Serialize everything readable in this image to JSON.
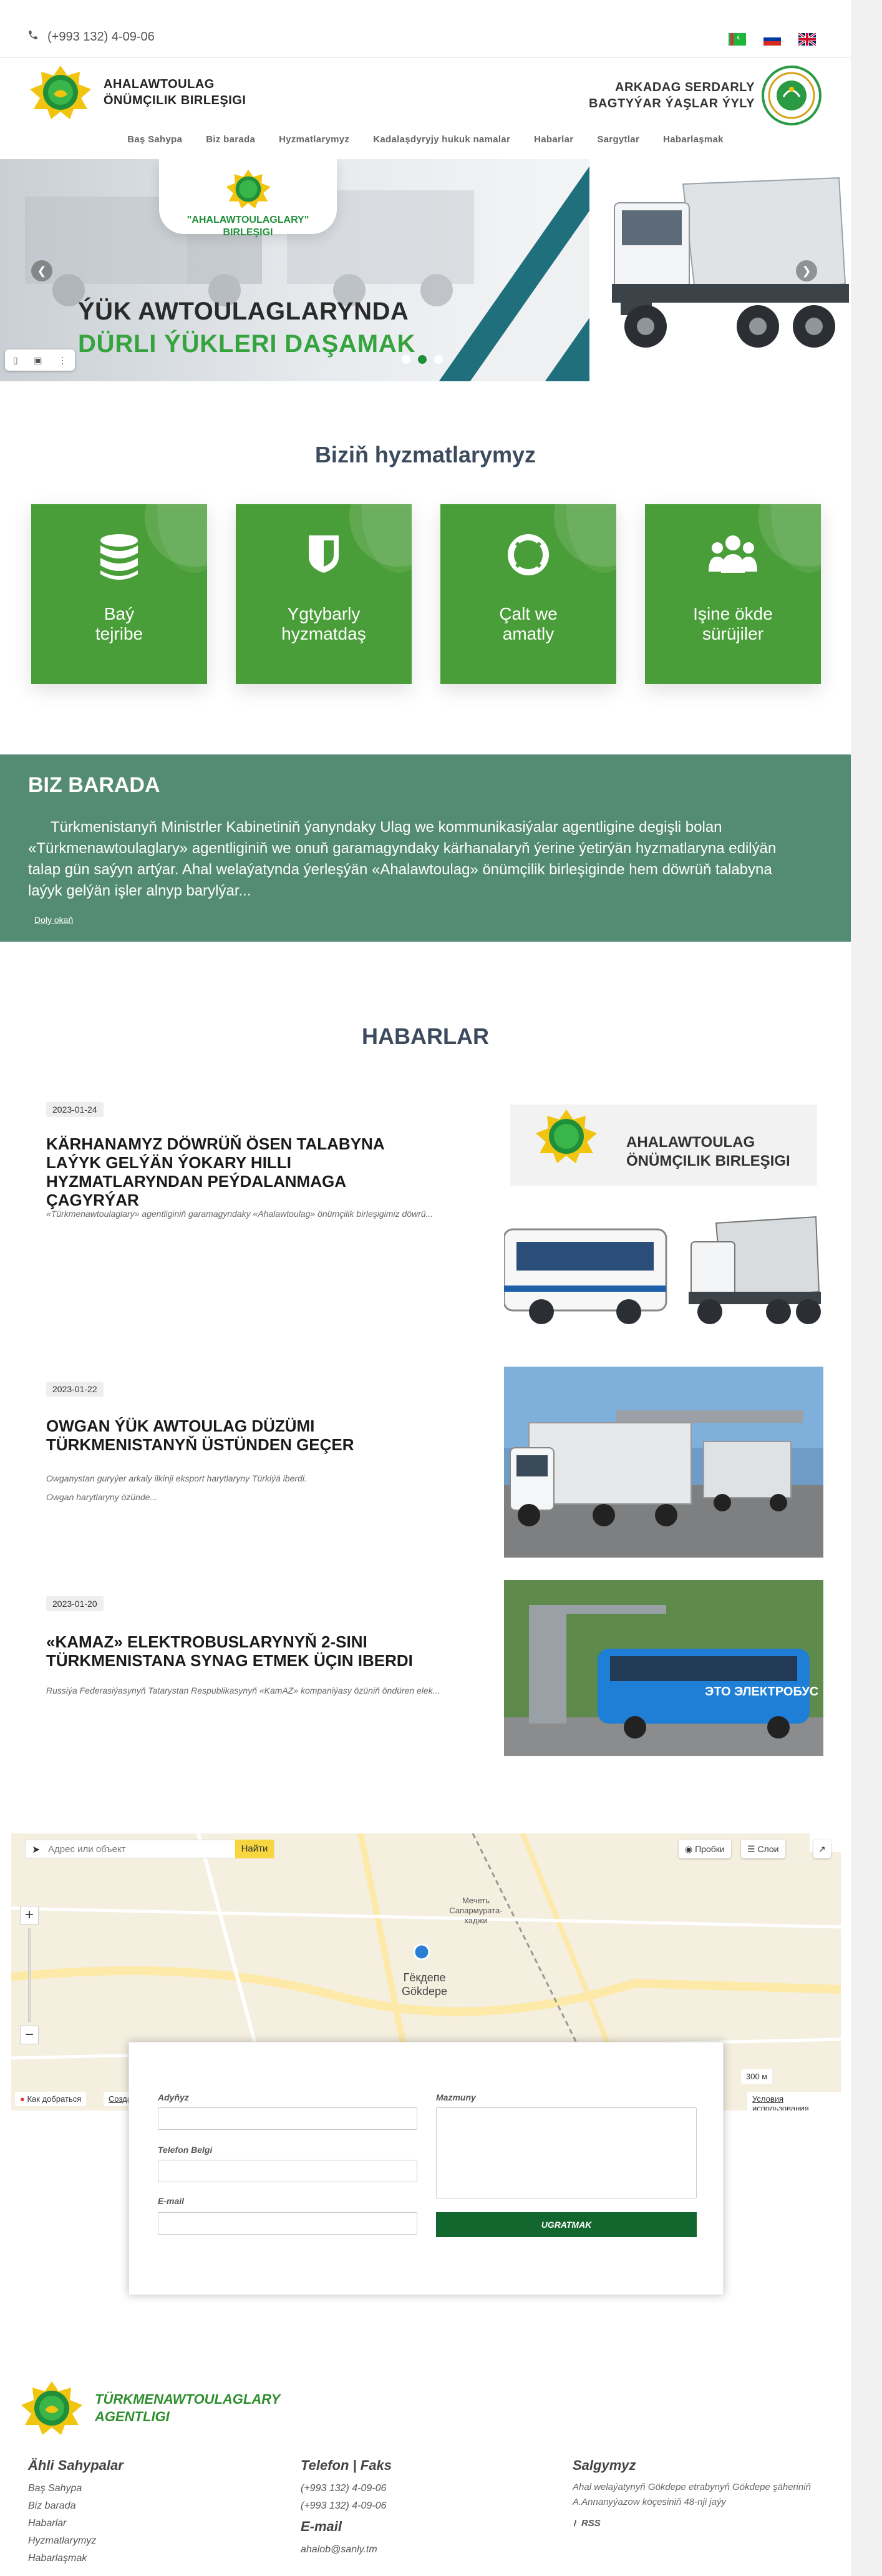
{
  "topbar": {
    "phone": "(+993 132) 4-09-06",
    "flags": [
      "tm-flag",
      "ru-flag",
      "uk-flag"
    ]
  },
  "header": {
    "logo_left_line1": "AHALAWTOULAG",
    "logo_left_line2": "ÖNÜMÇILIK BIRLEŞIGI",
    "logo_right_line1": "ARKADAG SERDARLY",
    "logo_right_line2": "BAGTYÝAR ÝAŞLAR ÝYLY"
  },
  "nav": [
    "Baş Sahypa",
    "Biz barada",
    "Hyzmatlarymyz",
    "Kadalaşdyryjy hukuk namalar",
    "Habarlar",
    "Sargytlar",
    "Habarlaşmak"
  ],
  "hero": {
    "badge_line1": "\"AHALAWTOULAGLARY\"",
    "badge_line2": "BIRLEŞIGI",
    "title1": "ÝÜK AWTOULAGLARYNDA",
    "title2": "DÜRLI ÝÜKLERI  DAŞAMAK",
    "slides": 3,
    "active_slide": 2
  },
  "services": {
    "title": "Biziň hyzmatlarymyz",
    "items": [
      {
        "line1": "Baý",
        "line2": "tejribe",
        "icon": "database-icon"
      },
      {
        "line1": "Ygtybarly",
        "line2": "hyzmatdaş",
        "icon": "shield-icon"
      },
      {
        "line1": "Çalt we",
        "line2": "amatly",
        "icon": "lifebuoy-icon"
      },
      {
        "line1": "Işine ökde",
        "line2": "sürüjiler",
        "icon": "users-icon"
      }
    ]
  },
  "about": {
    "title": "BIZ BARADA",
    "text": "Türkmenistanyň Ministrler Kabinetiniň ýanyndaky Ulag we kommunikasiýalar agentligine degişli bolan «Türkmenawtoulaglary» agentliginiň we onuň garamagyndaky kärhanalaryň ýerine ýetirýän hyzmatlaryna edilýän talap gün saýyn artýar. Ahal welaýatynda ýerleşýän «Ahalawtoulag» önümçilik birleşiginde hem döwrüň talabyna laýyk gelýän işler alnyp barylýar...",
    "more": "Doly okaň"
  },
  "news": {
    "title": "HABARLAR",
    "items": [
      {
        "date": "2023-01-24",
        "headline": "KÄRHANAMYZ DÖWRÜŇ ÖSEN TALABYNA LAÝYK GELÝÄN ÝOKARY HILLI HYZMATLARYNDAN PEÝDALANMAGA ÇAGYRÝAR",
        "body1": "«Türkmenawtoulaglary» agentliginiň garamagyndaky «Ahalawtoulag» önümçilik birleşigimiz döwrü...",
        "body2": "",
        "image_caption1": "AHALAWTOULAG",
        "image_caption2": "ÖNÜMÇILIK BIRLEŞIGI"
      },
      {
        "date": "2023-01-22",
        "headline": "OWGAN ÝÜK AWTOULAG DÜZÜMI TÜRKMENISTANYŇ ÜSTÜNDEN GEÇER",
        "body1": "Owganystan guryýer arkaly ilkinji eksport harytlaryny Türkiýä iberdi.",
        "body2": "Owgan harytlaryny özünde...",
        "image_caption1": "",
        "image_caption2": ""
      },
      {
        "date": "2023-01-20",
        "headline": "«KAMAZ» ELEKTROBUSLARYNYŇ 2-SINI TÜRKMENISTANA SYNAG ETMEK ÜÇIN IBERDI",
        "body1": "Russiýa Federasiýasynyň Tatarystan Respublikasynyň «KamAZ» kompaniýasy özüniň öndüren elek...",
        "body2": "",
        "image_caption1": "",
        "image_caption2": "ЭТО ЭЛЕКТРОБУС"
      }
    ]
  },
  "map": {
    "search_placeholder": "Адрес или объект",
    "find_label": "Найти",
    "traffic_label": "Пробки",
    "layers_label": "Слои",
    "city_ru": "Гёкдепе",
    "city_tm": "Gökdepe",
    "mosque": "Мечеть Сапармурата-хаджи",
    "route_label": "Как добраться",
    "create_label": "Создать",
    "terms_label": "Условия использования",
    "scale_label": "300 м"
  },
  "form": {
    "name_label": "Adyňyz",
    "phone_label": "Telefon Belgi",
    "email_label": "E-mail",
    "message_label": "Mazmuny",
    "submit_label": "UGRATMAK"
  },
  "footer": {
    "logo_line1": "TÜRKMENAWTOULAGLARY",
    "logo_line2": "AGENTLIGI",
    "col1_title": "Ähli Sahypalar",
    "col1_items": [
      "Baş Sahypa",
      "Biz barada",
      "Habarlar",
      "Hyzmatlarymyz",
      "Habarlaşmak"
    ],
    "col2_title": "Telefon | Faks",
    "col2_items": [
      "(+993 132) 4-09-06",
      "(+993 132) 4-09-06"
    ],
    "col2_email_title": "E-mail",
    "col2_email": "ahalob@sanly.tm",
    "col3_title": "Salgymyz",
    "col3_address": "Ahal welaýatynyň Gökdepe etrabynyň Gökdepe şäheriniň A.Annanyýazow köçesiniň 48-nji jaýy",
    "col3_rss": "RSS"
  },
  "colors": {
    "brand_green": "#4a9e39",
    "about_bg": "#548c73",
    "submit_bg": "#11672d",
    "heading": "#3b4a5c"
  }
}
